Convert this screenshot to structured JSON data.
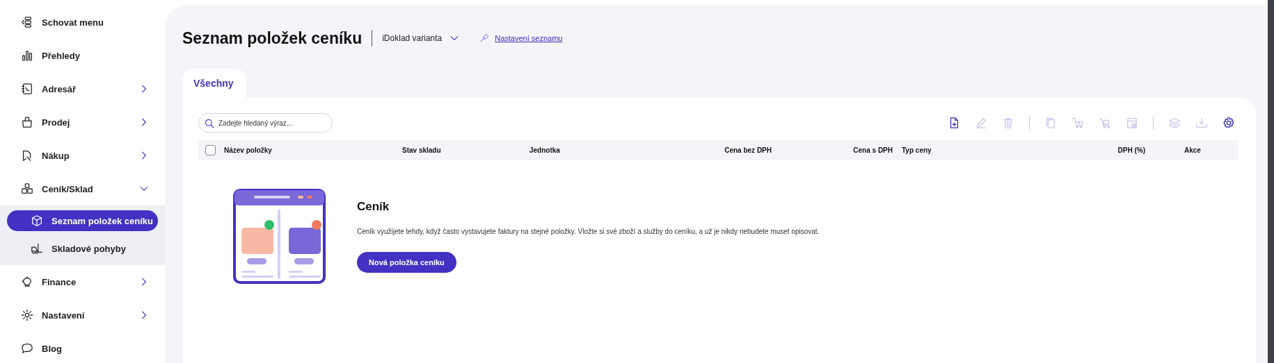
{
  "sidebar": {
    "items": [
      {
        "label": "Schovat menu"
      },
      {
        "label": "Přehledy"
      },
      {
        "label": "Adresář",
        "expanded": false
      },
      {
        "label": "Prodej",
        "expanded": false
      },
      {
        "label": "Nákup",
        "expanded": false
      },
      {
        "label": "Ceník/Sklad",
        "expanded": true,
        "children": [
          {
            "label": "Seznam položek ceníku",
            "selected": true
          },
          {
            "label": "Skladové pohyby",
            "selected": false
          }
        ]
      },
      {
        "label": "Finance",
        "expanded": false
      },
      {
        "label": "Nastavení",
        "expanded": false
      },
      {
        "label": "Blog"
      }
    ]
  },
  "header": {
    "title": "Seznam položek ceníku",
    "variant": "iDoklad varianta",
    "settings_link": "Nastavení seznamu"
  },
  "tabs": [
    {
      "label": "Všechny",
      "selected": true
    }
  ],
  "search": {
    "placeholder": "Zadejte hledaný výraz..."
  },
  "toolbar": [
    [
      {
        "disabled": false
      },
      {
        "disabled": true
      },
      {
        "disabled": true
      }
    ],
    [
      {
        "disabled": true
      },
      {
        "disabled": true
      },
      {
        "disabled": true
      },
      {
        "disabled": true
      }
    ],
    [
      {
        "disabled": true
      },
      {
        "disabled": true
      },
      {
        "disabled": false
      }
    ]
  ],
  "table": {
    "select_all": {
      "checked": false
    },
    "columns": [
      "Název položky",
      "Stav skladu",
      "Jednotka",
      "Cena bez DPH",
      "Cena s DPH",
      "Typ ceny",
      "DPH (%)",
      "Akce"
    ]
  },
  "empty_state": {
    "title": "Ceník",
    "text": "Ceník využijete tehdy, když často vystavujete faktury na stejné položky. Vložte si své zboží a služby do ceníku, a už je nikdy nebudete muset opisovat.",
    "button": "Nová položka ceníku"
  }
}
